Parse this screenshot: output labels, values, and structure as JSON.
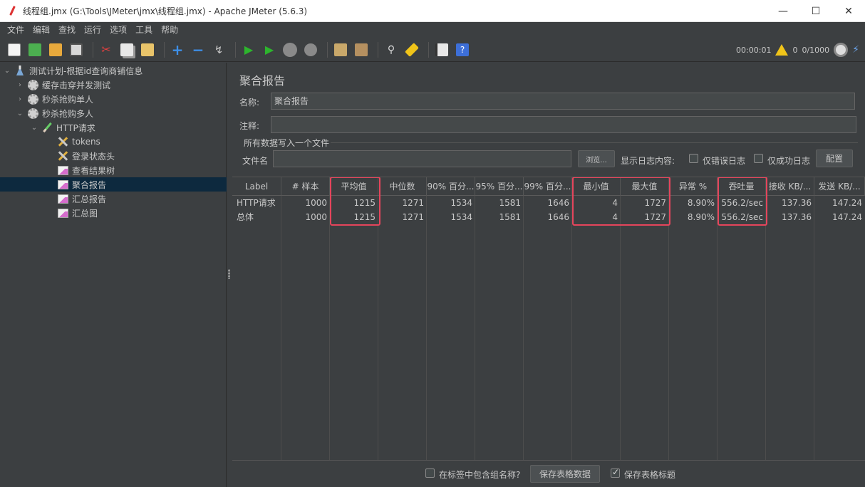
{
  "window": {
    "title": "线程组.jmx (G:\\Tools\\JMeter\\jmx\\线程组.jmx) - Apache JMeter (5.6.3)",
    "minimize": "—",
    "maximize": "☐",
    "close": "✕"
  },
  "menu": [
    "文件",
    "编辑",
    "查找",
    "运行",
    "选项",
    "工具",
    "帮助"
  ],
  "toolbar": {
    "timer": "00:00:01",
    "warnings": "0",
    "threads": "0/1000"
  },
  "tree": {
    "root": "测试计划-根据id查询商铺信息",
    "groups": [
      "缓存击穿并发测试",
      "秒杀抢购单人",
      "秒杀抢购多人"
    ],
    "sampler": "HTTP请求",
    "children": [
      "tokens",
      "登录状态头",
      "查看结果树",
      "聚合报告",
      "汇总报告",
      "汇总图"
    ]
  },
  "panel": {
    "title": "聚合报告",
    "name_label": "名称:",
    "name_value": "聚合报告",
    "comment_label": "注释:",
    "comment_value": "",
    "file_group": "所有数据写入一个文件",
    "filename_label": "文件名",
    "filename_value": "",
    "browse": "浏览...",
    "log_label": "显示日志内容:",
    "errors_only": "仅错误日志",
    "success_only": "仅成功日志",
    "configure": "配置"
  },
  "table": {
    "columns": [
      "Label",
      "# 样本",
      "平均值",
      "中位数",
      "90% 百分...",
      "95% 百分...",
      "99% 百分...",
      "最小值",
      "最大值",
      "异常 %",
      "吞吐量",
      "接收 KB/...",
      "发送 KB/..."
    ],
    "rows": [
      [
        "HTTP请求",
        "1000",
        "1215",
        "1271",
        "1534",
        "1581",
        "1646",
        "4",
        "1727",
        "8.90%",
        "556.2/sec",
        "137.36",
        "147.24"
      ],
      [
        "总体",
        "1000",
        "1215",
        "1271",
        "1534",
        "1581",
        "1646",
        "4",
        "1727",
        "8.90%",
        "556.2/sec",
        "137.36",
        "147.24"
      ]
    ]
  },
  "bottom": {
    "include_group": "在标签中包含组名称?",
    "save_table": "保存表格数据",
    "save_header": "保存表格标题"
  }
}
